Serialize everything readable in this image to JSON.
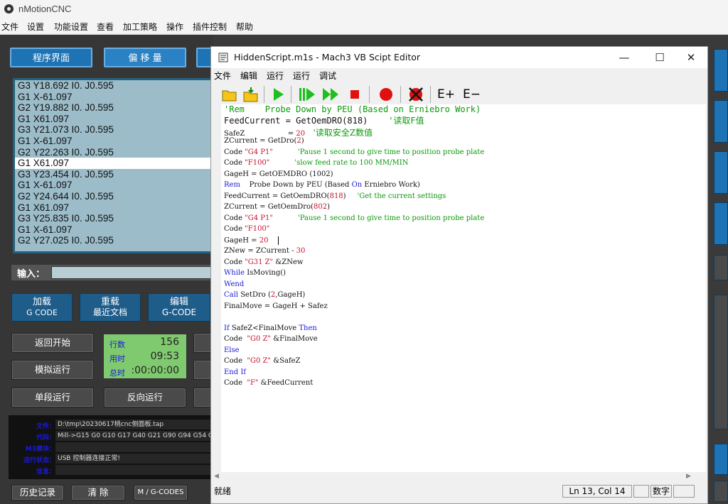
{
  "app": {
    "title": "nMotionCNC",
    "menu": [
      "文件",
      "设置",
      "功能设置",
      "查看",
      "加工策略",
      "操作",
      "插件控制",
      "帮助"
    ]
  },
  "left": {
    "tabs": [
      "程序界面",
      "偏 移 量"
    ],
    "gcode_lines": [
      "G3 Y18.692 I0. J0.595",
      "G1 X-61.097",
      "G2 Y19.882 I0. J0.595",
      "G1 X61.097",
      "G3 Y21.073 I0. J0.595",
      "G1 X-61.097",
      "G2 Y22.263 I0. J0.595",
      "G1 X61.097",
      "G3 Y23.454 I0. J0.595",
      "G1 X-61.097",
      "G2 Y24.644 I0. J0.595",
      "G1 X61.097",
      "G3 Y25.835 I0. J0.595",
      "G1 X-61.097",
      "G2 Y27.025 I0. J0.595"
    ],
    "selected_line_index": 7,
    "input_label": "输入：",
    "btn_load_1": "加载",
    "btn_load_2": "G CODE",
    "btn_reload_1": "重载",
    "btn_reload_2": "最近文档",
    "btn_edit_1": "编辑",
    "btn_edit_2": "G-CODE",
    "btn_return_start": "返回开始",
    "btn_simulate": "模拟运行",
    "btn_single_step": "单段运行",
    "btn_reverse": "反向运行",
    "stats": {
      "lines_label": "行数",
      "lines_value": "156",
      "used_label": "用时",
      "used_value": "09:53",
      "total_label": "总时",
      "total_value": ":00:00:00"
    },
    "info": {
      "file_label": "文件：",
      "file_value": "D:\\tmp\\20230617桃cnc侧面板.tap",
      "code_label": "代码：",
      "code_value": "Mill->G15  G0 G10 G17 G40 G21 G90 G94 G54 G43",
      "m3_label": "M3模块：",
      "status_label": "运行状态：",
      "status_value": "USB 控制器连接正常!",
      "msg_label": "信息："
    },
    "btn_history": "历史记录",
    "btn_clear": "清 除",
    "btn_mg": "M / G-CODES"
  },
  "editor": {
    "title": "HiddenScript.m1s - Mach3 VB Scipt Editor",
    "minimize": "—",
    "maximize": "☐",
    "close": "✕",
    "menu": [
      "文件",
      "编辑",
      "运行",
      "运行",
      "调试"
    ],
    "toolbar_e_plus": "E+",
    "toolbar_e_minus": "E−",
    "status_ready": "就绪",
    "status_pos": "Ln 13, Col 14",
    "status_mode": "数字",
    "code": {
      "l1_a": "'Rem    Probe Down by PEU (Based on Erniebro Work)",
      "l2_a": "FeedCurrent = GetOemDRO(818)",
      "l2_c": "    '读取F值",
      "l3_a": "SafeZ                   = ",
      "l3_n": "20",
      "l3_c": "   '读取安全Z数值",
      "l4_a": "ZCurrent = GetDro(",
      "l4_n": "2",
      "l4_b": ")",
      "l5_a": "Code ",
      "l5_s": "\"G4 P1\"",
      "l5_c": "           'Pause 1 second to give time to position probe plate",
      "l6_a": "Code ",
      "l6_s": "\"F100\"",
      "l6_c": "           'slow feed rate to 100 MM/MIN",
      "l7_a": "GageH = GetOEMDRO (1002)",
      "l8_k": "Rem",
      "l8_a": "    Probe Down by PEU (Based ",
      "l8_k2": "On",
      "l8_b": " Erniebro Work)",
      "l9_a": "FeedCurrent = GetOemDRO(",
      "l9_n": "818",
      "l9_b": ")",
      "l9_c": "     'Get the current settings",
      "l10_a": "ZCurrent = GetOemDro(",
      "l10_n": "802",
      "l10_b": ")",
      "l11_a": "Code ",
      "l11_s": "\"G4 P1\"",
      "l11_c": "           'Pause 1 second to give time to position probe plate",
      "l12_a": "Code ",
      "l12_s": "\"F100\"",
      "l13_a": "GageH = ",
      "l13_n": "20",
      "l14_a": "ZNew = ZCurrent - ",
      "l14_n": "30",
      "l15_a": "Code ",
      "l15_s": "\"G31 Z\"",
      "l15_b": " &ZNew",
      "l16_k": "While",
      "l16_a": " IsMoving()",
      "l17_k": "Wend",
      "l18_k": "Call",
      "l18_a": " SetDro (",
      "l18_n": "2",
      "l18_b": ",GageH)",
      "l19_a": "FinalMove = GageH + Safez",
      "l20_k": "If",
      "l20_a": " SafeZ<FinalMove ",
      "l20_k2": "Then",
      "l21_a": "Code  ",
      "l21_s": "\"G0 Z\"",
      "l21_b": " &FinalMove",
      "l22_k": "Else",
      "l23_a": "Code  ",
      "l23_s": "\"G0 Z\"",
      "l23_b": " &SafeZ",
      "l24_k": "End If",
      "l25_a": "Code  ",
      "l25_s": "\"F\"",
      "l25_b": " &FeedCurrent"
    }
  },
  "colors": {
    "tab_blue": "#1e73b4",
    "code_bg": "#9bbcc8",
    "stat_green": "#7fc96e",
    "comment_green": "#0a9a0a",
    "string_red": "#c8102e",
    "keyword_blue": "#1a1ad8"
  }
}
